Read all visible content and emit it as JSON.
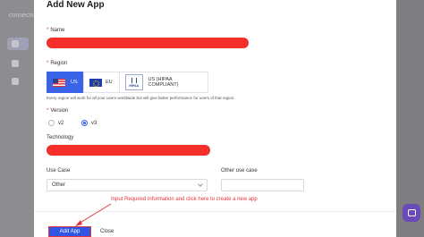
{
  "background_app": {
    "brand": "connectio"
  },
  "modal": {
    "title": "Add New App",
    "name_label": "Name",
    "region_label": "Region",
    "region_options": [
      {
        "label": "US",
        "icon": "us-flag-icon",
        "selected": true
      },
      {
        "label": "EU",
        "icon": "eu-flag-icon",
        "selected": false
      },
      {
        "label": "US (HIPAA COMPLIANT)",
        "icon": "hipaa-logo-icon",
        "selected": false,
        "logo_text": "HIPAA"
      }
    ],
    "region_hint": "Every region will work for all your users worldwide but will give better performance for users of that region.",
    "version_label": "Version",
    "version_options": [
      {
        "label": "v2",
        "checked": false
      },
      {
        "label": "v3",
        "checked": true
      }
    ],
    "technology_label": "Technology",
    "use_case_label": "Use Case",
    "use_case_value": "Other",
    "other_use_case_label": "Other use case",
    "other_use_case_value": "",
    "annotation": "Input Required information and click here to create a new app",
    "add_button": "Add App",
    "close_button": "Close"
  },
  "colors": {
    "accent": "#2f55e4",
    "required": "#e0343f",
    "redaction": "#f32f2a",
    "chat": "#6a4ab8"
  }
}
